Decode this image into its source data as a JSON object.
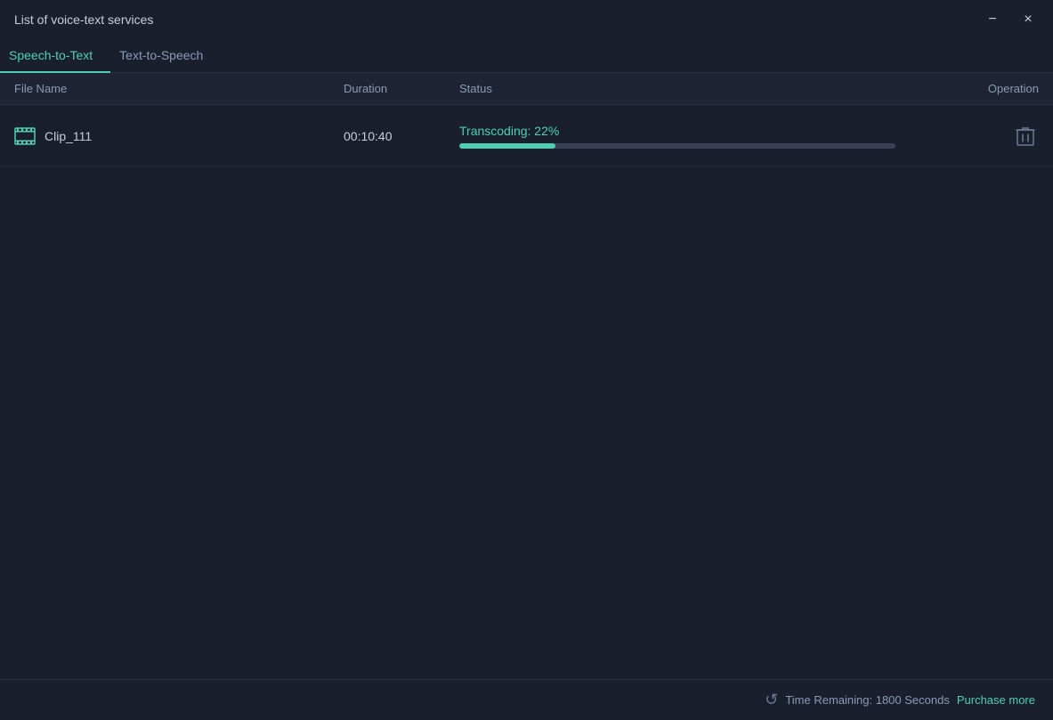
{
  "window": {
    "title": "List of voice-text services",
    "minimize_label": "−",
    "close_label": "×"
  },
  "tabs": [
    {
      "id": "speech-to-text",
      "label": "Speech-to-Text",
      "active": true
    },
    {
      "id": "text-to-speech",
      "label": "Text-to-Speech",
      "active": false
    }
  ],
  "table": {
    "headers": {
      "filename": "File Name",
      "duration": "Duration",
      "status": "Status",
      "operation": "Operation"
    },
    "rows": [
      {
        "filename": "Clip_111",
        "duration": "00:10:40",
        "status_label": "Transcoding:  22%",
        "progress_percent": 22,
        "has_delete": true
      }
    ]
  },
  "footer": {
    "time_remaining_text": "Time Remaining: 1800 Seconds",
    "purchase_link": "Purchase more"
  },
  "icons": {
    "film": "🎞",
    "trash": "🗑",
    "refresh": "↺"
  }
}
